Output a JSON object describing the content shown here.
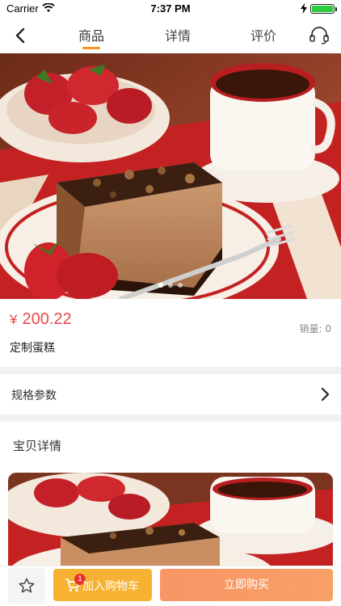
{
  "status_bar": {
    "carrier": "Carrier",
    "time": "7:37 PM"
  },
  "nav": {
    "tabs": [
      {
        "label": "商品",
        "active": true
      },
      {
        "label": "详情",
        "active": false
      },
      {
        "label": "评价",
        "active": false
      }
    ],
    "accent_color": "#f7941d"
  },
  "carousel": {
    "slide_count": 3,
    "current_slide": 1
  },
  "product": {
    "currency": "¥",
    "price": "200.22",
    "name": "定制蛋糕",
    "sales_label": "销量: 0",
    "price_color": "#e8494c"
  },
  "spec": {
    "label": "规格参数"
  },
  "details": {
    "title": "宝贝详情"
  },
  "bottom_bar": {
    "cart_badge": "1",
    "cart_label": "加入购物车",
    "buy_label": "立即购买",
    "cart_color": "#f7b233",
    "buy_color": "#f99566"
  },
  "icons": {
    "back": "chevron-left-icon",
    "service": "headset-icon",
    "spec_arrow": "chevron-right-icon",
    "favorite": "star-icon",
    "cart": "cart-icon"
  }
}
